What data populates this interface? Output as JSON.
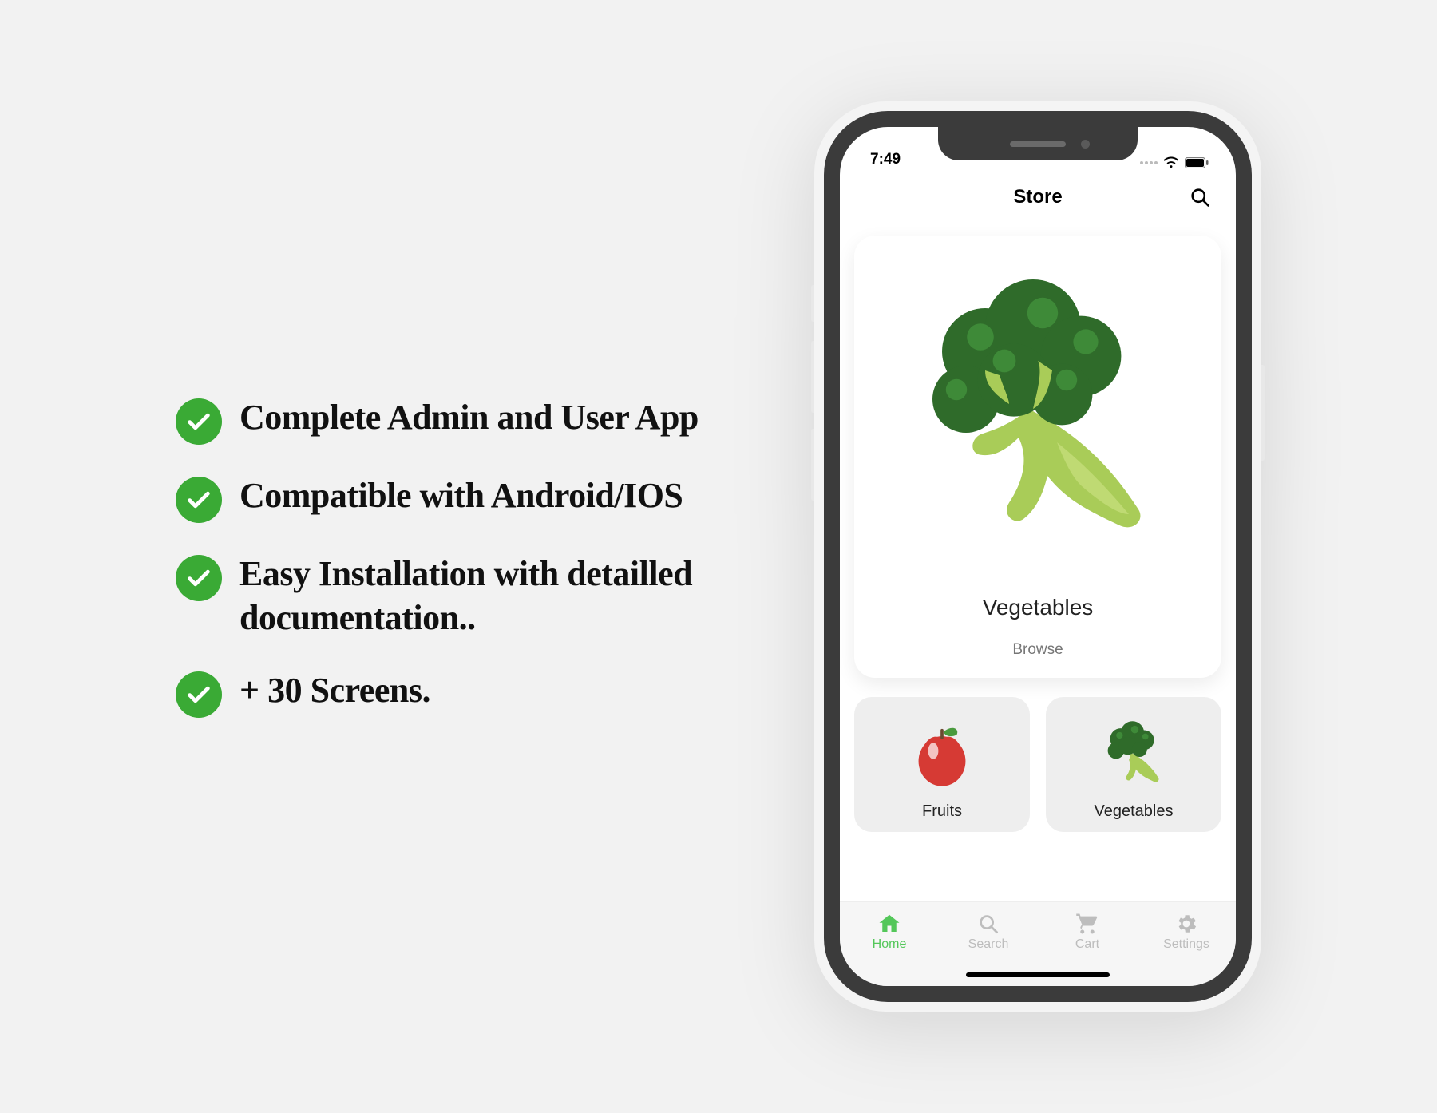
{
  "features": [
    "Complete Admin and User App",
    "Compatible with Android/IOS",
    "Easy Installation with detailled documentation..",
    "+ 30 Screens."
  ],
  "phone": {
    "status_time": "7:49",
    "header_title": "Store",
    "hero": {
      "title": "Vegetables",
      "action": "Browse"
    },
    "tiles": [
      {
        "label": "Fruits"
      },
      {
        "label": "Vegetables"
      }
    ],
    "nav": [
      {
        "label": "Home",
        "active": true
      },
      {
        "label": "Search",
        "active": false
      },
      {
        "label": "Cart",
        "active": false
      },
      {
        "label": "Settings",
        "active": false
      }
    ]
  },
  "colors": {
    "accent_green": "#3aaa35",
    "nav_active": "#54c75a"
  }
}
